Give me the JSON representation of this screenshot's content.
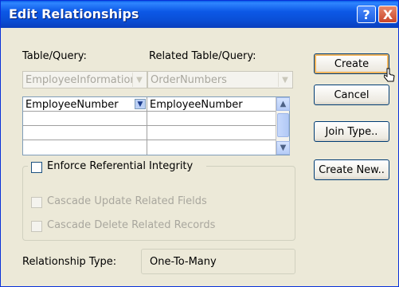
{
  "window": {
    "title": "Edit Relationships",
    "help_glyph": "?",
    "close_glyph": "X"
  },
  "table_query": {
    "label": "Table/Query:",
    "value": "EmployeeInformation"
  },
  "related_table_query": {
    "label": "Related Table/Query:",
    "value": "OrderNumbers"
  },
  "fields_grid": {
    "rows": [
      {
        "left": "EmployeeNumber",
        "right": "EmployeeNumber"
      },
      {
        "left": "",
        "right": ""
      },
      {
        "left": "",
        "right": ""
      },
      {
        "left": "",
        "right": ""
      }
    ]
  },
  "buttons": {
    "create": "Create",
    "cancel": "Cancel",
    "join_type": "Join Type..",
    "create_new": "Create New.."
  },
  "options": {
    "enforce_referential_integrity": {
      "label": "Enforce Referential Integrity",
      "checked": false
    },
    "cascade_update": {
      "label": "Cascade Update Related Fields",
      "checked": false,
      "enabled": false
    },
    "cascade_delete": {
      "label": "Cascade Delete Related Records",
      "checked": false,
      "enabled": false
    }
  },
  "relationship_type": {
    "label": "Relationship Type:",
    "value": "One-To-Many"
  },
  "colors": {
    "titlebar": "#0a4fd7",
    "dialog_bg": "#ece9d8",
    "default_button_highlight": "#f0b45c"
  }
}
